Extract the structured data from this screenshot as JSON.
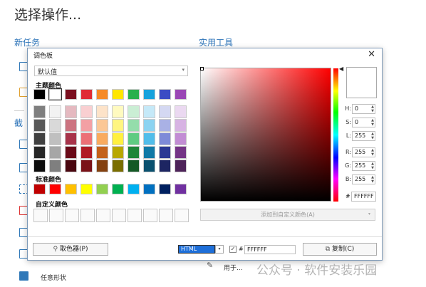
{
  "background": {
    "title": "选择操作...",
    "new_task": "新任务",
    "tools": "实用工具",
    "capture_partial": "截",
    "shape_label": "任意形状",
    "bottom_partial": "用于..."
  },
  "dialog": {
    "title": "调色板",
    "close": "✕",
    "preset": "默认值",
    "theme_colors_label": "主题颜色",
    "theme_colors": [
      "#000000",
      "#ffffff",
      "#7b1020",
      "#e02a34",
      "#f68a27",
      "#ffe600",
      "#28b04c",
      "#16a2dd",
      "#3b4cc4",
      "#9a47b5"
    ],
    "tint_columns": [
      [
        "#7f7f7f",
        "#595959",
        "#404040",
        "#262626",
        "#0d0d0d"
      ],
      [
        "#f2f2f2",
        "#d9d9d9",
        "#bfbfbf",
        "#a6a6a6",
        "#7f7f7f"
      ],
      [
        "#e5b9c0",
        "#cc7380",
        "#a8334a",
        "#6a0a18",
        "#4a0710"
      ],
      [
        "#f9cfd1",
        "#f3a0a4",
        "#ec7076",
        "#b01b24",
        "#7a1218"
      ],
      [
        "#fde3c9",
        "#fbc795",
        "#f9ab5f",
        "#c4621a",
        "#844110"
      ],
      [
        "#fffac0",
        "#fff580",
        "#fff040",
        "#b8a700",
        "#7a6e00"
      ],
      [
        "#caeed4",
        "#94ddab",
        "#5fcb82",
        "#1e8538",
        "#145925"
      ],
      [
        "#c5e9f8",
        "#8bd3f1",
        "#51bdea",
        "#1079a6",
        "#0a516f"
      ],
      [
        "#d4d8f2",
        "#a9b1e5",
        "#7e8ad8",
        "#2b3893",
        "#1d2562"
      ],
      [
        "#ebd9f1",
        "#d7b3e3",
        "#c28dd4",
        "#743486",
        "#4d2359"
      ]
    ],
    "standard_colors_label": "标准颜色",
    "standard_colors": [
      "#c00000",
      "#ff0000",
      "#ffc000",
      "#ffff00",
      "#92d050",
      "#00b050",
      "#00b0f0",
      "#0070c0",
      "#002060",
      "#7030a0"
    ],
    "custom_colors_label": "自定义颜色",
    "custom_colors": [
      "",
      "",
      "",
      "",
      "",
      "",
      "",
      "",
      "",
      ""
    ],
    "hsl_rgb": [
      {
        "label": "H:",
        "value": "0"
      },
      {
        "label": "S:",
        "value": "0"
      },
      {
        "label": "L:",
        "value": "255"
      },
      {
        "label": "R:",
        "value": "255"
      },
      {
        "label": "G:",
        "value": "255"
      },
      {
        "label": "B:",
        "value": "255"
      }
    ],
    "hex_label": "#",
    "hex_value": "FFFFFF",
    "add_custom": "添加到自定义颜色(A)",
    "picker_button": "取色器(P)",
    "format_select": "HTML",
    "format_checkbox": "✓",
    "hex_out_label": "#",
    "hex_out": "FFFFFF",
    "copy_button": "复制(C)"
  },
  "watermark": "公众号 · 软件安装乐园"
}
